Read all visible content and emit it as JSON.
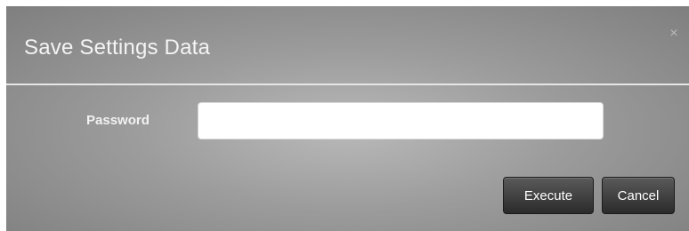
{
  "dialog": {
    "title": "Save Settings Data",
    "close_symbol": "×",
    "form": {
      "password_label": "Password",
      "password_value": ""
    },
    "buttons": {
      "execute": "Execute",
      "cancel": "Cancel"
    }
  },
  "icons": {
    "close": "close-icon"
  },
  "colors": {
    "dialog_background": "#9c9c9c",
    "title_text": "#f4f4f4",
    "button_background": "#3a3a3a",
    "input_background": "#ffffff"
  }
}
